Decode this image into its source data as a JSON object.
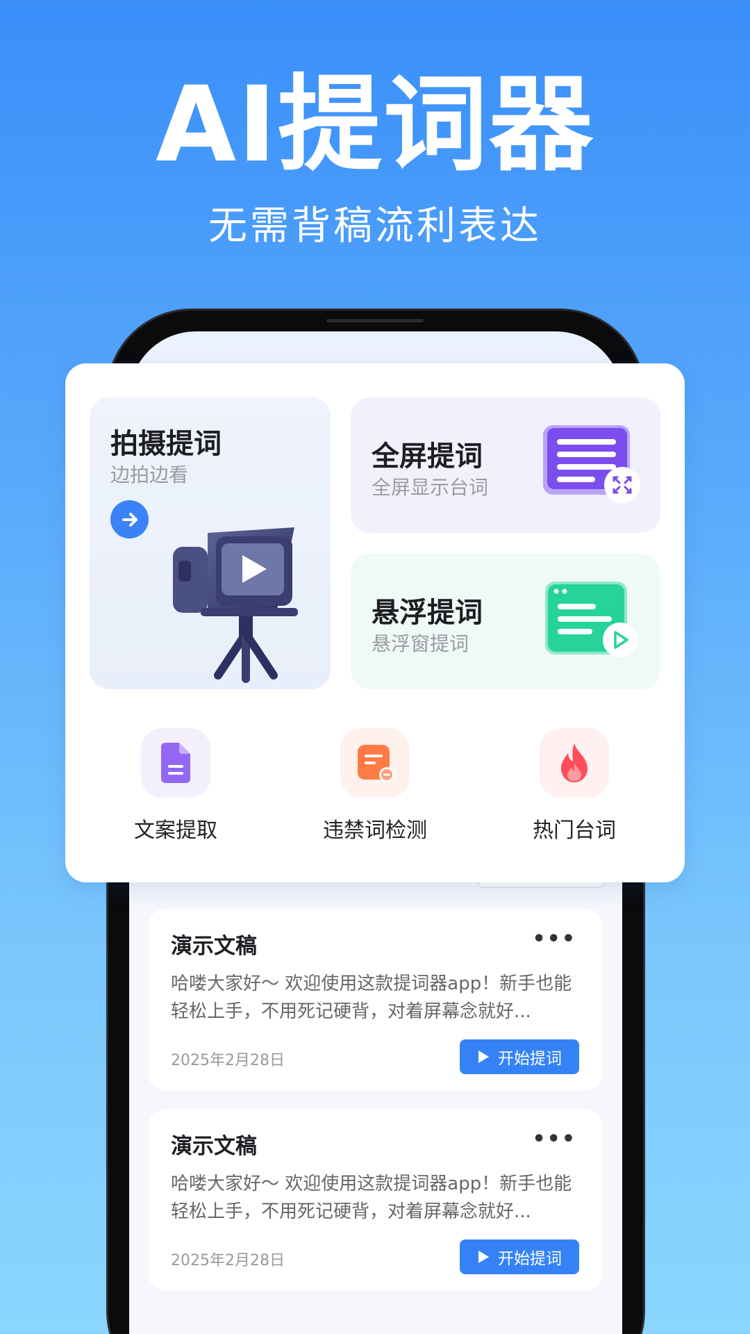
{
  "hero": {
    "title": "AI提词器",
    "subtitle": "无需背稿流利表达"
  },
  "features": {
    "shoot": {
      "title": "拍摄提词",
      "subtitle": "边拍边看"
    },
    "fullscreen": {
      "title": "全屏提词",
      "subtitle": "全屏显示台词"
    },
    "floating": {
      "title": "悬浮提词",
      "subtitle": "悬浮窗提词"
    }
  },
  "quick_actions": [
    {
      "label": "文案提取",
      "icon": "document-icon"
    },
    {
      "label": "违禁词检测",
      "icon": "forbidden-words-icon"
    },
    {
      "label": "热门台词",
      "icon": "fire-icon"
    }
  ],
  "scripts": [
    {
      "title": "演示文稿",
      "body": "哈喽大家好～ 欢迎使用这款提词器app！新手也能轻松上手，不用死记硬背，对着屏幕念就好...",
      "date": "2025年2月28日",
      "button": "开始提词"
    },
    {
      "title": "演示文稿",
      "body": "哈喽大家好～ 欢迎使用这款提词器app！新手也能轻松上手，不用死记硬背，对着屏幕念就好...",
      "date": "2025年2月28日",
      "button": "开始提词"
    }
  ],
  "colors": {
    "accent": "#3482f6",
    "purple": "#7c4dee",
    "green": "#26d39a",
    "orange": "#ff7a45",
    "red": "#ff4d5a"
  }
}
